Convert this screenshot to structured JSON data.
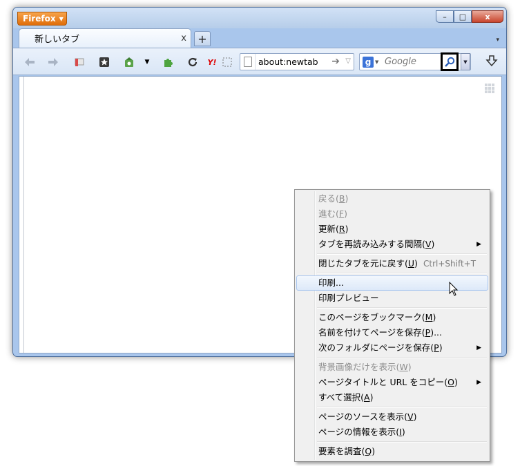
{
  "window": {
    "app_button_label": "Firefox",
    "controls": {
      "minimize": "–",
      "maximize": "□",
      "close": "x"
    }
  },
  "tabs": [
    {
      "title": "新しいタブ",
      "close": "x"
    }
  ],
  "tabbar": {
    "new_tab": "+",
    "tab_list": "▾"
  },
  "toolbar": {
    "icons": [
      "back-icon",
      "forward-icon",
      "bookmark-flag-icon",
      "bookmarks-star-icon",
      "home-icon",
      "dropdown-icon",
      "addon-puzzle-icon",
      "reload-icon",
      "yahoo-icon",
      "selection-icon"
    ],
    "yahoo_label": "Y!"
  },
  "urlbar": {
    "value": "about:newtab"
  },
  "searchbar": {
    "engine": "g",
    "placeholder": "Google"
  },
  "context_menu": {
    "items": [
      {
        "label": "戻る(",
        "key": "B",
        "tail": ")",
        "disabled": true
      },
      {
        "label": "進む(",
        "key": "F",
        "tail": ")",
        "disabled": true
      },
      {
        "label": "更新(",
        "key": "R",
        "tail": ")"
      },
      {
        "label": "タブを再読み込みする間隔(",
        "key": "V",
        "tail": ")",
        "submenu": true
      },
      {
        "label": "閉じたタブを元に戻す(",
        "key": "U",
        "tail": ")",
        "shortcut": "Ctrl+Shift+T"
      },
      {
        "label": "印刷...",
        "highlighted": true
      },
      {
        "label": "印刷プレビュー"
      },
      {
        "label": "このページをブックマーク(",
        "key": "M",
        "tail": ")"
      },
      {
        "label": "名前を付けてページを保存(",
        "key": "P",
        "tail": ")..."
      },
      {
        "label": "次のフォルダにページを保存(",
        "key": "P",
        "tail": ")",
        "submenu": true
      },
      {
        "label": "背景画像だけを表示(",
        "key": "W",
        "tail": ")",
        "disabled": true
      },
      {
        "label": "ページタイトルと URL をコピー(",
        "key": "O",
        "tail": ")",
        "submenu": true
      },
      {
        "label": "すべて選択(",
        "key": "A",
        "tail": ")"
      },
      {
        "label": "ページのソースを表示(",
        "key": "V",
        "tail": ")"
      },
      {
        "label": "ページの情報を表示(",
        "key": "I",
        "tail": ")"
      },
      {
        "label": "要素を調査(",
        "key": "Q",
        "tail": ")"
      }
    ]
  }
}
